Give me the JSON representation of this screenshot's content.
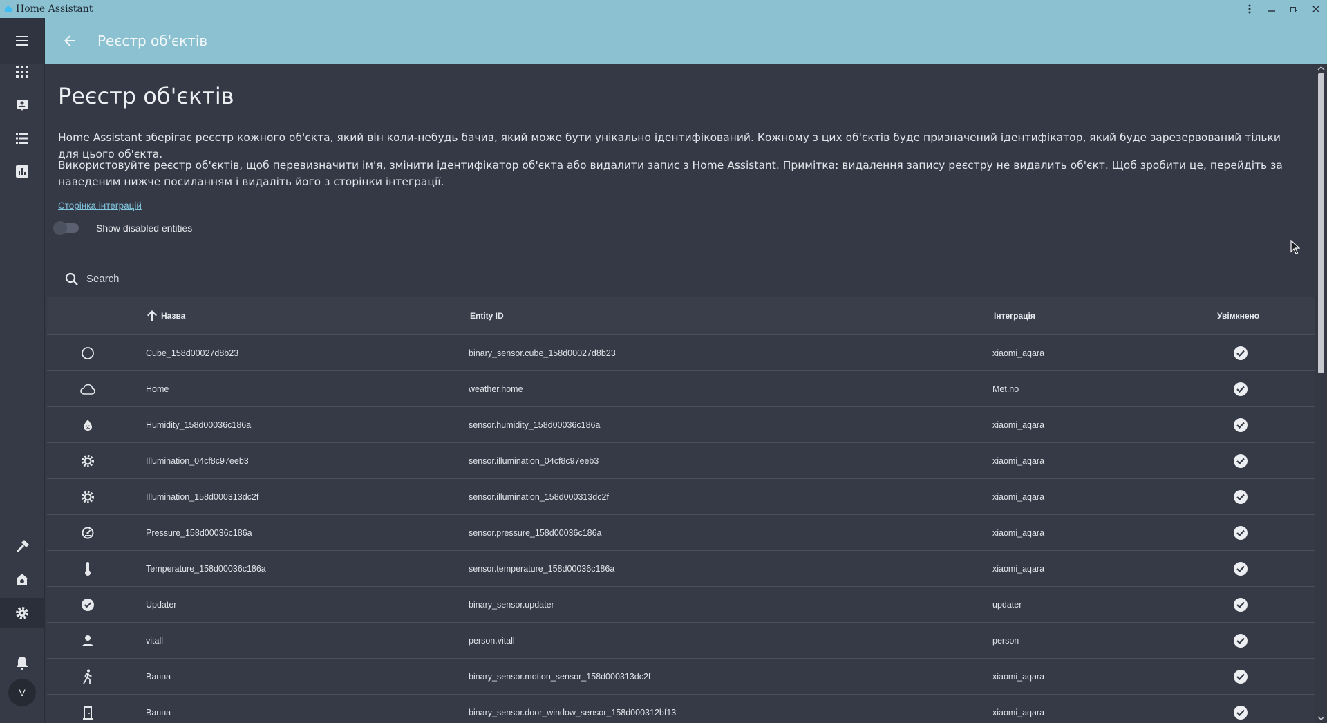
{
  "window": {
    "title": "Home Assistant"
  },
  "header": {
    "title": "Реєстр об'єктів"
  },
  "page": {
    "title": "Реєстр об'єктів",
    "description_1": "Home Assistant зберігає реєстр кожного об'єкта, який він коли-небудь бачив, який може бути унікально ідентифікований. Кожному з цих об'єктів буде призначений ідентифікатор, який буде зарезервований тільки для цього об'єкта.",
    "description_2": "Використовуйте реєстр об'єктів, щоб перевизначити ім'я, змінити ідентифікатор об'єкта або видалити запис з Home Assistant. Примітка: видалення запису реєстру не видалить об'єкт. Щоб зробити це, перейдіть за наведеним нижче посиланням і видаліть його з сторінки інтеграції.",
    "integrations_link": "Сторінка інтеграцій",
    "show_disabled_label": "Show disabled entities",
    "show_disabled": false
  },
  "search": {
    "placeholder": "Search"
  },
  "sidebar": {
    "items": [
      {
        "icon": "menu-icon"
      },
      {
        "icon": "dashboard-icon"
      },
      {
        "icon": "map-icon"
      },
      {
        "icon": "logbook-icon"
      },
      {
        "icon": "history-icon"
      },
      {
        "icon": "developer-tools-icon"
      },
      {
        "icon": "supervisor-icon"
      },
      {
        "icon": "settings-icon",
        "active": true
      },
      {
        "icon": "notifications-icon"
      }
    ],
    "avatar_initial": "V"
  },
  "table": {
    "columns": {
      "name": "Назва",
      "entity_id": "Entity ID",
      "integration": "Інтеграція",
      "enabled": "Увімкнено"
    },
    "sort": {
      "column": "name",
      "direction": "ascending"
    },
    "rows": [
      {
        "icon": "circle-outline-icon",
        "name": "Cube_158d00027d8b23",
        "entity_id": "binary_sensor.cube_158d00027d8b23",
        "integration": "xiaomi_aqara",
        "enabled": true
      },
      {
        "icon": "cloud-icon",
        "name": "Home",
        "entity_id": "weather.home",
        "integration": "Met.no",
        "enabled": true
      },
      {
        "icon": "water-percent-icon",
        "name": "Humidity_158d00036c186a",
        "entity_id": "sensor.humidity_158d00036c186a",
        "integration": "xiaomi_aqara",
        "enabled": true
      },
      {
        "icon": "brightness-icon",
        "name": "Illumination_04cf8c97eeb3",
        "entity_id": "sensor.illumination_04cf8c97eeb3",
        "integration": "xiaomi_aqara",
        "enabled": true
      },
      {
        "icon": "brightness-icon",
        "name": "Illumination_158d000313dc2f",
        "entity_id": "sensor.illumination_158d000313dc2f",
        "integration": "xiaomi_aqara",
        "enabled": true
      },
      {
        "icon": "gauge-icon",
        "name": "Pressure_158d00036c186a",
        "entity_id": "sensor.pressure_158d00036c186a",
        "integration": "xiaomi_aqara",
        "enabled": true
      },
      {
        "icon": "thermometer-icon",
        "name": "Temperature_158d00036c186a",
        "entity_id": "sensor.temperature_158d00036c186a",
        "integration": "xiaomi_aqara",
        "enabled": true
      },
      {
        "icon": "check-circle-icon",
        "name": "Updater",
        "entity_id": "binary_sensor.updater",
        "integration": "updater",
        "enabled": true
      },
      {
        "icon": "person-icon",
        "name": "vitall",
        "entity_id": "person.vitall",
        "integration": "person",
        "enabled": true
      },
      {
        "icon": "walk-icon",
        "name": "Ванна",
        "entity_id": "binary_sensor.motion_sensor_158d000313dc2f",
        "integration": "xiaomi_aqara",
        "enabled": true
      },
      {
        "icon": "door-icon",
        "name": "Ванна",
        "entity_id": "binary_sensor.door_window_sensor_158d000312bf13",
        "integration": "xiaomi_aqara",
        "enabled": true
      }
    ]
  }
}
